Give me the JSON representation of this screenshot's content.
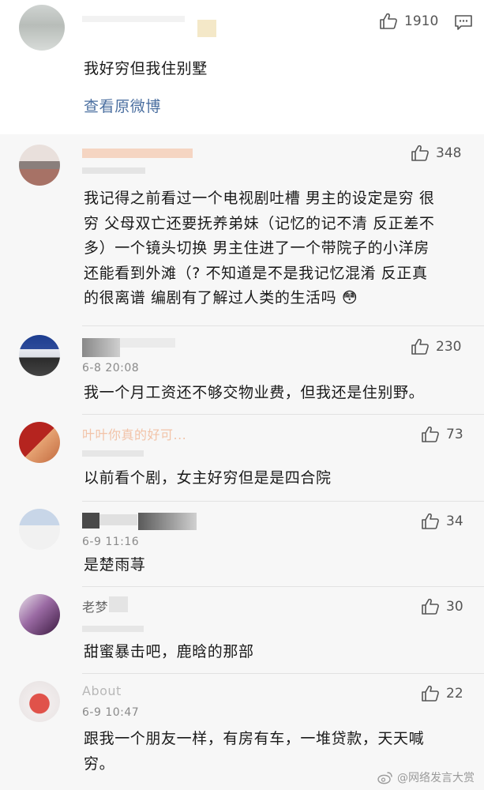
{
  "main_comment": {
    "likes": "1910",
    "text": "我好穷但我住别墅",
    "view_original": "查看原微博"
  },
  "replies": [
    {
      "name": "",
      "time": "",
      "likes": "348",
      "lines": [
        "我记得之前看过一个电视剧吐槽 男主的设定是穷 很",
        "穷 父母双亡还要抚养弟妹（记忆的记不清 反正差不",
        "多）一个镜头切换 男主住进了一个带院子的小洋房",
        "还能看到外滩（? 不知道是不是我记忆混淆 反正真",
        "的很离谱 编剧有了解过人类的生活吗"
      ],
      "emoji": "😳"
    },
    {
      "name": "",
      "time": "6-8 20:08",
      "likes": "230",
      "lines": [
        "我一个月工资还不够交物业费，但我还是住别野。"
      ]
    },
    {
      "name": "叶叶你真的好可...",
      "time": "",
      "likes": "73",
      "lines": [
        "以前看个剧，女主好穷但是是四合院"
      ]
    },
    {
      "name": "",
      "time": "6-9 11:16",
      "likes": "34",
      "lines": [
        "是楚雨荨"
      ]
    },
    {
      "name": "老梦",
      "time": "",
      "likes": "30",
      "lines": [
        "甜蜜暴击吧，鹿晗的那部"
      ]
    },
    {
      "name": "About",
      "time": "6-9 10:47",
      "likes": "22",
      "lines": [
        "跟我一个朋友一样，有房有车，一堆贷款，天天喊",
        "穷。"
      ]
    }
  ],
  "watermark": "@网络发言大赏",
  "colors": {
    "link": "#4b6fa0",
    "name_orange": "#e98c44",
    "like_gray": "#555555"
  },
  "icons": [
    "thumbs-up-icon",
    "comment-icon",
    "flushed-face-emoji",
    "weibo-logo-icon"
  ]
}
